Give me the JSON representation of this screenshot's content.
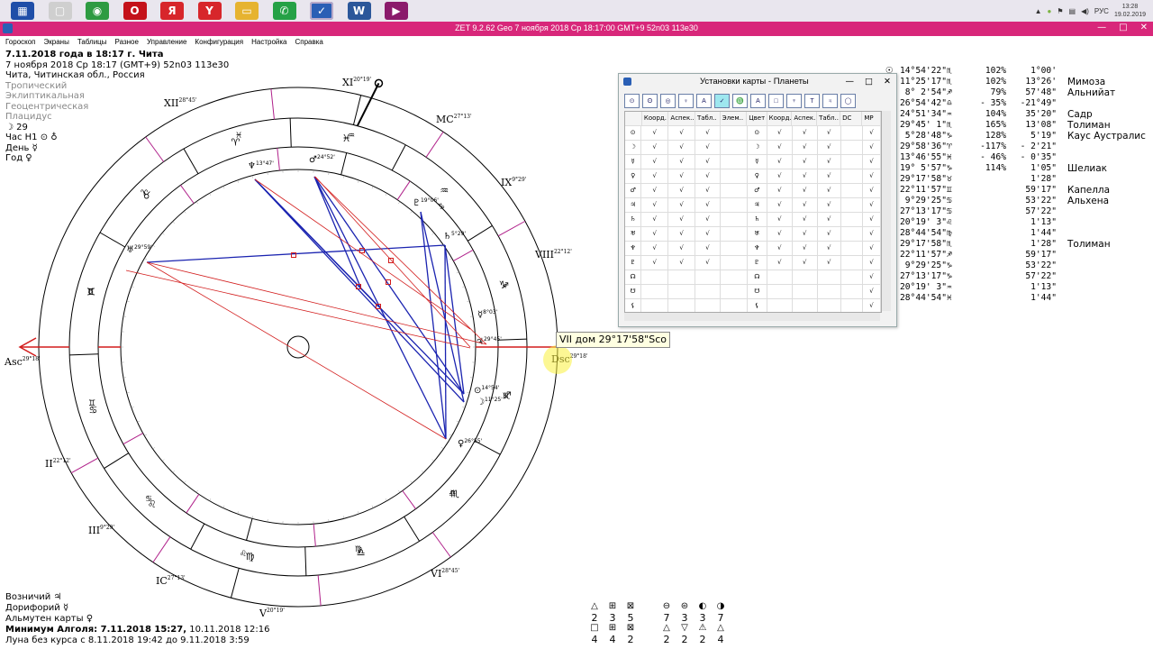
{
  "taskbar": {
    "apps": [
      {
        "name": "explorer",
        "label": "▦",
        "color": "#1f4ea8"
      },
      {
        "name": "blank",
        "label": "▢",
        "color": "#cfcfcf"
      },
      {
        "name": "chrome",
        "label": "◉",
        "color": "#2e9b42"
      },
      {
        "name": "opera",
        "label": "O",
        "color": "#c4121a"
      },
      {
        "name": "yandex",
        "label": "Я",
        "color": "#d7262b"
      },
      {
        "name": "yandex-browser",
        "label": "Y",
        "color": "#d7262b"
      },
      {
        "name": "files",
        "label": "▭",
        "color": "#e6b330"
      },
      {
        "name": "whatsapp",
        "label": "✆",
        "color": "#25a146"
      },
      {
        "name": "zet",
        "label": "✓",
        "color": "#2a5fb5"
      },
      {
        "name": "word",
        "label": "W",
        "color": "#2b579a"
      },
      {
        "name": "media",
        "label": "▶",
        "color": "#8b1a6b"
      }
    ],
    "lang": "РУС",
    "time": "13:28",
    "date": "19.02.2019"
  },
  "window": {
    "title": "ZET 9.2.62 Geo    7 ноября 2018  Ср   18:17:00 GMT+9 52n03  113e30",
    "minimize": "—",
    "maximize": "□",
    "close": "✕"
  },
  "menu": [
    "Гороскоп",
    "Экраны",
    "Таблицы",
    "Разное",
    "Управление",
    "Конфигурация",
    "Настройка",
    "Справка"
  ],
  "info": {
    "line1": "7.11.2018 года в 18:17 г. Чита",
    "line2": "7 ноября 2018  Ср  18:17 (GMT+9) 52n03  113e30",
    "line3": "Чита, Читинская обл., Россия",
    "system": [
      "Тропический",
      "Эклиптикальная",
      "Геоцентрическая",
      "Плацидус"
    ],
    "moonday": "☽ 29",
    "hour": "Час Н1 ⊙ ♁",
    "day": "День ☿",
    "year": "Год ♀"
  },
  "bottom": {
    "l1": "Возничий ♃",
    "l2": "Дорифорий ☿",
    "l3": "Альмутен карты ♀",
    "l4a": "Минимум Алголя: 7.11.2018 15:27,",
    "l4b": " 10.11.2018 12:16",
    "l5": "Луна без курса с 8.11.2018 19:42 до 9.11.2018  3:59"
  },
  "planets": [
    {
      "g": "☉",
      "pos": "14°54'22\"♏",
      "sp": "102%",
      "lat": "1°00'",
      "star": ""
    },
    {
      "g": "☽",
      "pos": "11°25'17\"♏",
      "sp": "102%",
      "lat": "13°26'",
      "star": "Мимоза"
    },
    {
      "g": "☿",
      "pos": " 8° 2'54\"♐",
      "sp": "79%",
      "lat": "57'48\"",
      "star": "Альнийат"
    },
    {
      "g": "♀",
      "pos": "26°54'42\"♎",
      "sp": "- 35%",
      "lat": "-21°49\"",
      "star": ""
    },
    {
      "g": "♂",
      "pos": "24°51'34\"♒",
      "sp": "104%",
      "lat": "35'20\"",
      "star": "Садр"
    },
    {
      "g": "♃",
      "pos": "29°45' 1\"♏",
      "sp": "165%",
      "lat": "13'08\"",
      "star": "Толиман"
    },
    {
      "g": "♄",
      "pos": " 5°28'48\"♑",
      "sp": "128%",
      "lat": "5'19\"",
      "star": "Каус Аустралис"
    },
    {
      "g": "♅",
      "pos": "29°58'36\"♈",
      "sp": "-117%",
      "lat": "- 2'21\"",
      "star": ""
    },
    {
      "g": "♆",
      "pos": "13°46'55\"♓",
      "sp": "- 46%",
      "lat": "- 0'35\"",
      "star": ""
    },
    {
      "g": "♇",
      "pos": "19° 5'57\"♑",
      "sp": "114%",
      "lat": "1'05\"",
      "star": "Шелиак"
    },
    {
      "g": "☊",
      "pos": "29°17'58\"♉",
      "sp": "",
      "lat": "1'28\"",
      "star": ""
    },
    {
      "g": "☋",
      "pos": "22°11'57\"♊",
      "sp": "",
      "lat": "59'17\"",
      "star": "Капелла"
    },
    {
      "g": "⚸",
      "pos": " 9°29'25\"♋",
      "sp": "",
      "lat": "53'22\"",
      "star": "Альхена"
    },
    {
      "g": "⚷",
      "pos": "27°13'17\"♋",
      "sp": "",
      "lat": "57'22\"",
      "star": ""
    },
    {
      "g": "⚴",
      "pos": "20°19' 3\"♌",
      "sp": "",
      "lat": "1'13\"",
      "star": ""
    },
    {
      "g": "⚵",
      "pos": "28°44'54\"♍",
      "sp": "",
      "lat": "1'44\"",
      "star": ""
    },
    {
      "g": "⚶",
      "pos": "29°17'58\"♏",
      "sp": "",
      "lat": "1'28\"",
      "star": "Толиман"
    },
    {
      "g": "♁",
      "pos": "22°11'57\"♐",
      "sp": "",
      "lat": "59'17\"",
      "star": ""
    },
    {
      "g": "⊕",
      "pos": " 9°29'25\"♑",
      "sp": "",
      "lat": "53'22\"",
      "star": ""
    },
    {
      "g": "⊗",
      "pos": "27°13'17\"♑",
      "sp": "",
      "lat": "57'22\"",
      "star": ""
    },
    {
      "g": "⊙",
      "pos": "20°19' 3\"♒",
      "sp": "",
      "lat": "1'13\"",
      "star": ""
    },
    {
      "g": "⊚",
      "pos": "28°44'54\"♓",
      "sp": "",
      "lat": "1'44\"",
      "star": ""
    }
  ],
  "dialog": {
    "title": "Установки карты - Планеты",
    "min": "—",
    "max": "□",
    "close": "✕",
    "tools": [
      "⊙",
      "ʘ",
      "◎",
      "♀",
      "A",
      "✓",
      "♎",
      "A",
      "□",
      "♆",
      "T",
      "♃",
      "◯"
    ],
    "headers": [
      "",
      "Коорд.",
      "Аспек..",
      "Табл..",
      "Элем..",
      "Цвет",
      "Коорд.",
      "Аспек..",
      "Табл..",
      "DC",
      "",
      "МР"
    ],
    "rows": [
      {
        "g": "⊙",
        "c": [
          "√",
          "√",
          "√",
          "",
          "⊙",
          "√",
          "√",
          "√",
          "",
          "",
          "√"
        ]
      },
      {
        "g": "☽",
        "c": [
          "√",
          "√",
          "√",
          "",
          "☽",
          "√",
          "√",
          "√",
          "",
          "",
          "√"
        ]
      },
      {
        "g": "☿",
        "c": [
          "√",
          "√",
          "√",
          "",
          "☿",
          "√",
          "√",
          "√",
          "",
          "",
          "√"
        ]
      },
      {
        "g": "♀",
        "c": [
          "√",
          "√",
          "√",
          "",
          "♀",
          "√",
          "√",
          "√",
          "",
          "",
          "√"
        ]
      },
      {
        "g": "♂",
        "c": [
          "√",
          "√",
          "√",
          "",
          "♂",
          "√",
          "√",
          "√",
          "",
          "",
          "√"
        ]
      },
      {
        "g": "♃",
        "c": [
          "√",
          "√",
          "√",
          "",
          "♃",
          "√",
          "√",
          "√",
          "",
          "",
          "√"
        ]
      },
      {
        "g": "♄",
        "c": [
          "√",
          "√",
          "√",
          "",
          "♄",
          "√",
          "√",
          "√",
          "",
          "",
          "√"
        ]
      },
      {
        "g": "♅",
        "c": [
          "√",
          "√",
          "√",
          "",
          "♅",
          "√",
          "√",
          "√",
          "",
          "",
          "√"
        ]
      },
      {
        "g": "♆",
        "c": [
          "√",
          "√",
          "√",
          "",
          "♆",
          "√",
          "√",
          "√",
          "",
          "",
          "√"
        ]
      },
      {
        "g": "♇",
        "c": [
          "√",
          "√",
          "√",
          "",
          "♇",
          "√",
          "√",
          "√",
          "",
          "",
          "√"
        ]
      },
      {
        "g": "☊",
        "c": [
          "",
          "",
          "",
          "",
          "☊",
          "",
          "",
          "",
          "",
          "",
          "√"
        ]
      },
      {
        "g": "☋",
        "c": [
          "",
          "",
          "",
          "",
          "☋",
          "",
          "",
          "",
          "",
          "",
          "√"
        ]
      },
      {
        "g": "⚸",
        "c": [
          "",
          "",
          "",
          "",
          "⚸",
          "",
          "",
          "",
          "",
          "",
          "√"
        ]
      },
      {
        "g": "⚷",
        "c": [
          "",
          "",
          "",
          "",
          "⚷",
          "",
          "",
          "",
          "",
          "",
          "√"
        ]
      }
    ]
  },
  "tooltip": "VII дом 29°17'58\"Sco",
  "houses": [
    {
      "label": "Asc",
      "deg": "29°18'"
    },
    {
      "label": "II",
      "deg": "22°12'"
    },
    {
      "label": "III",
      "deg": "9°29'"
    },
    {
      "label": "IC",
      "deg": "27°13'"
    },
    {
      "label": "V",
      "deg": "20°19'"
    },
    {
      "label": "VI",
      "deg": "28°45'"
    },
    {
      "label": "Dsc",
      "deg": "29°18'"
    },
    {
      "label": "VIII",
      "deg": "22°12'"
    },
    {
      "label": "IX",
      "deg": "9°29'"
    },
    {
      "label": "MC",
      "deg": "27°13'"
    },
    {
      "label": "XI",
      "deg": "20°19'"
    },
    {
      "label": "XII",
      "deg": "28°45'"
    }
  ],
  "chart_planets": [
    {
      "g": "♆",
      "deg": "13°47'"
    },
    {
      "g": "♂",
      "deg": "24°52'"
    },
    {
      "g": "♅",
      "deg": "29°59'"
    },
    {
      "g": "♇",
      "deg": "19°06'"
    },
    {
      "g": "♄",
      "deg": "5°29'"
    },
    {
      "g": "☿",
      "deg": "8°03'"
    },
    {
      "g": "♃",
      "deg": "29°45'"
    },
    {
      "g": "⊙",
      "deg": "14°54'"
    },
    {
      "g": "☽",
      "deg": "11°25'"
    },
    {
      "g": "♀",
      "deg": "26°55'"
    }
  ],
  "zodiac_signs": [
    "♊",
    "♉",
    "♈",
    "♓",
    "♒",
    "♑",
    "♐",
    "♏",
    "♎",
    "♍",
    "♌",
    "♋"
  ],
  "aspect_summary": {
    "glyphs": [
      "△",
      "⊞",
      "⊠",
      "",
      "⊖",
      "⊜",
      "◐",
      "◑"
    ],
    "row1": [
      "2",
      "3",
      "5",
      "",
      "7",
      "3",
      "3",
      "7"
    ],
    "glyphs2": [
      "□",
      "⊞",
      "⊠",
      "",
      "△",
      "▽",
      "⚠",
      "△"
    ],
    "row2": [
      "4",
      "4",
      "2",
      "",
      "2",
      "2",
      "2",
      "4"
    ]
  }
}
